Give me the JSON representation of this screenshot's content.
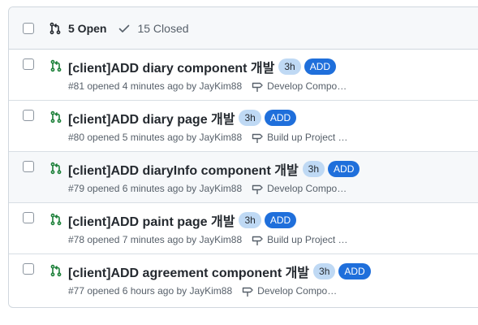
{
  "header": {
    "open_label": "5 Open",
    "closed_label": "15 Closed"
  },
  "issues": [
    {
      "title": "[client]ADD diary component 개발",
      "age_label": "3h",
      "tag_label": "ADD",
      "meta": "#81 opened 4 minutes ago by JayKim88",
      "milestone": "Develop Compo…"
    },
    {
      "title": "[client]ADD diary page 개발",
      "age_label": "3h",
      "tag_label": "ADD",
      "meta": "#80 opened 5 minutes ago by JayKim88",
      "milestone": "Build up Project …"
    },
    {
      "title": "[client]ADD diaryInfo component 개발",
      "age_label": "3h",
      "tag_label": "ADD",
      "meta": "#79 opened 6 minutes ago by JayKim88",
      "milestone": "Develop Compo…"
    },
    {
      "title": "[client]ADD paint page 개발",
      "age_label": "3h",
      "tag_label": "ADD",
      "meta": "#78 opened 7 minutes ago by JayKim88",
      "milestone": "Build up Project …"
    },
    {
      "title": "[client]ADD agreement component 개발",
      "age_label": "3h",
      "tag_label": "ADD",
      "meta": "#77 opened 6 hours ago by JayKim88",
      "milestone": "Develop Compo…"
    }
  ],
  "colors": {
    "open_icon": "#1a7f37",
    "label_add_bg": "#1f6fdb",
    "label_3h_bg": "#bfd9f4"
  },
  "icons": {
    "pr": "git-pull-request-icon",
    "check": "check-icon",
    "milestone": "milestone-icon"
  }
}
